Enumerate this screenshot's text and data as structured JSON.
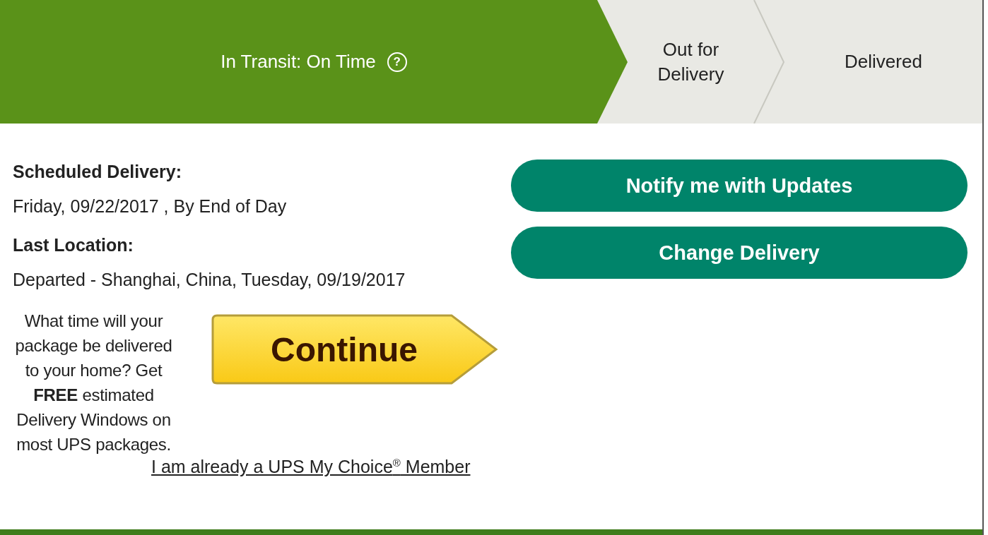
{
  "steps": [
    {
      "label": "In Transit: On Time",
      "help": "?",
      "selected": true
    },
    {
      "label": "Out for Delivery",
      "selected": false
    },
    {
      "label": "Delivered",
      "selected": false
    }
  ],
  "details": [
    {
      "label": "Scheduled Delivery:",
      "value": "Friday, 09/22/2017 , By End of Day"
    },
    {
      "label": "Last Location:",
      "value": "Departed - Shanghai, China, Tuesday, 09/19/2017"
    }
  ],
  "promo": {
    "text": "What time will your package be delivered to your home? Get **FREE** estimated Delivery Windows on most UPS packages.",
    "button": "Continue",
    "link": "I am already a UPS My Choice$^{®}$ Member"
  },
  "actions": [
    "Notify me with Updates",
    "Change Delivery"
  ]
}
